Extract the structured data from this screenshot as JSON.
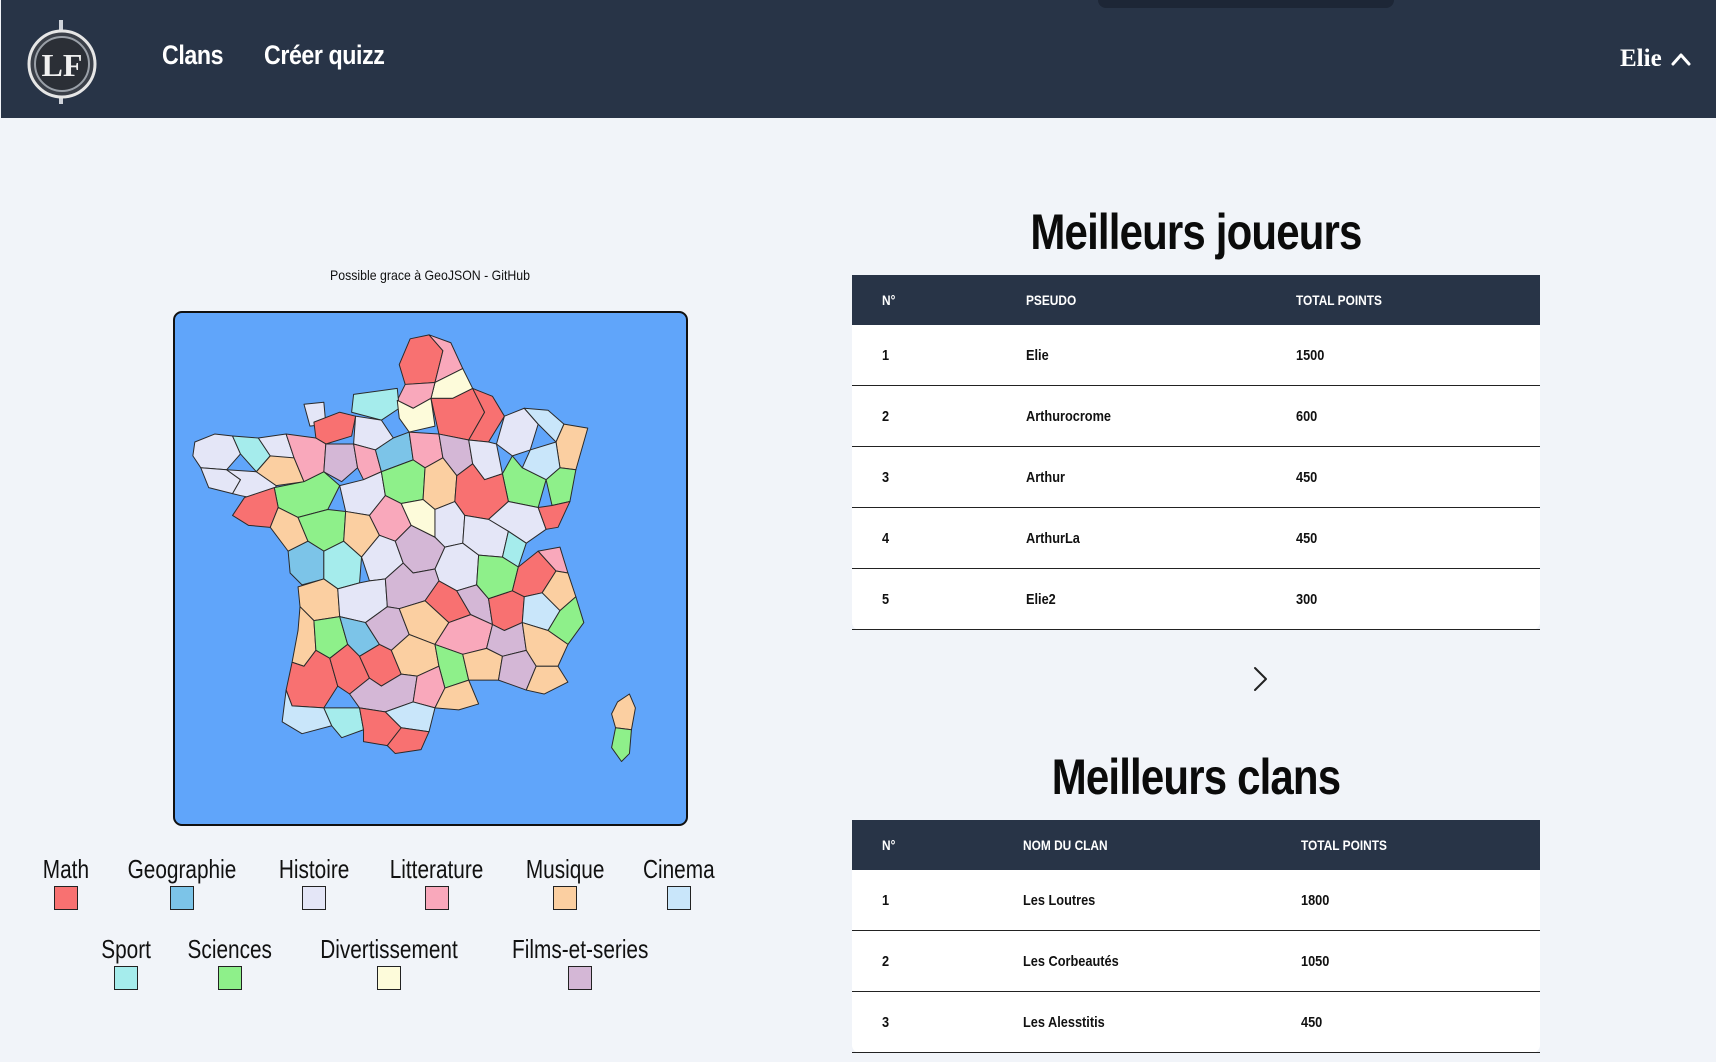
{
  "nav": {
    "links": [
      {
        "label": "Clans"
      },
      {
        "label": "Créer quizz"
      }
    ],
    "user": {
      "name": "Elie",
      "icon": "chevron-up-icon"
    },
    "logo": {
      "text": "LF",
      "icon": "logo-emblem-icon"
    }
  },
  "map": {
    "credit": "Possible grace à GeoJSON - GitHub",
    "background": "#60a5fa"
  },
  "legend": {
    "items": [
      {
        "label": "Math",
        "color": "#f87171"
      },
      {
        "label": "Geographie",
        "color": "#7cc4e8"
      },
      {
        "label": "Histoire",
        "color": "#e4e6f7"
      },
      {
        "label": "Litterature",
        "color": "#f9a8bb"
      },
      {
        "label": "Musique",
        "color": "#fbcfa1"
      },
      {
        "label": "Cinema",
        "color": "#c9e6fa"
      },
      {
        "label": "Sport",
        "color": "#a5ecec"
      },
      {
        "label": "Sciences",
        "color": "#8ef08a"
      },
      {
        "label": "Divertissement",
        "color": "#fdfbda"
      },
      {
        "label": "Films-et-series",
        "color": "#d4b7d6"
      }
    ]
  },
  "players": {
    "title": "Meilleurs joueurs",
    "headers": [
      "N°",
      "PSEUDO",
      "TOTAL POINTS"
    ],
    "rows": [
      [
        "1",
        "Elie",
        "1500"
      ],
      [
        "2",
        "Arthurocrome",
        "600"
      ],
      [
        "3",
        "Arthur",
        "450"
      ],
      [
        "4",
        "ArthurLa",
        "450"
      ],
      [
        "5",
        "Elie2",
        "300"
      ]
    ],
    "next_icon": "chevron-right-icon"
  },
  "clans": {
    "title": "Meilleurs clans",
    "headers": [
      "N°",
      "NOM DU CLAN",
      "TOTAL POINTS"
    ],
    "rows": [
      [
        "1",
        "Les Loutres",
        "1800"
      ],
      [
        "2",
        "Les Corbeautés",
        "1050"
      ],
      [
        "3",
        "Les Alesstitis",
        "450"
      ]
    ]
  }
}
